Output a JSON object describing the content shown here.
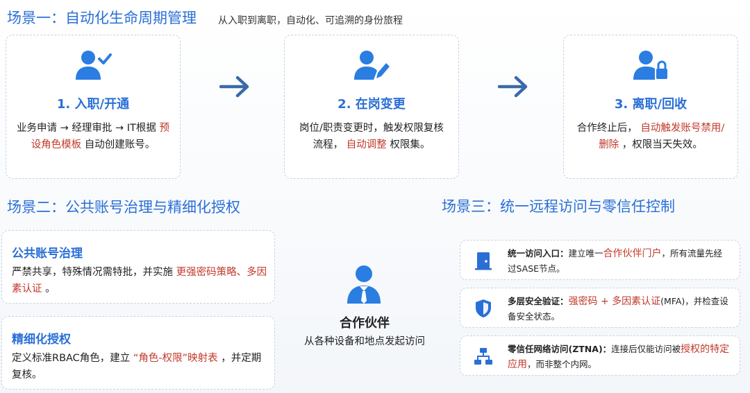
{
  "scene1": {
    "title": "场景一：自动化生命周期管理",
    "subtitle": "从入职到离职，自动化、可追溯的身份旅程",
    "steps": [
      {
        "title": "1. 入职/开通",
        "desc_a": "业务申请 → 经理审批 → IT根据",
        "desc_hl": "预设角色模板",
        "desc_b": "自动创建账号。",
        "icon": "user-check-icon"
      },
      {
        "title": "2. 在岗变更",
        "desc_a": "岗位/职责变更时，触发权限复核流程，",
        "desc_hl": "自动调整",
        "desc_b": "权限集。",
        "icon": "user-edit-icon"
      },
      {
        "title": "3. 离职/回收",
        "desc_a": "合作终止后，",
        "desc_hl": "自动触发账号禁用/删除",
        "desc_b": "，权限当天失效。",
        "icon": "user-lock-icon"
      }
    ]
  },
  "scene2": {
    "title": "场景二：公共账号治理与精细化授权",
    "cards": [
      {
        "title": "公共账号治理",
        "desc_a": "严禁共享，特殊情况需特批，并实施",
        "desc_hl": "更强密码策略、多因素认证",
        "desc_b": "。"
      },
      {
        "title": "精细化授权",
        "desc_a": "定义标准RBAC角色，建立",
        "desc_hl": "“角色-权限”映射表",
        "desc_b": "，并定期复核。"
      }
    ]
  },
  "partner": {
    "title": "合作伙伴",
    "subtitle": "从各种设备和地点发起访问",
    "icon": "partner-user-icon"
  },
  "scene3": {
    "title": "场景三：统一远程访问与零信任控制",
    "items": [
      {
        "label": "统一访问入口：",
        "desc_a": "建立唯一",
        "desc_hl": "合作伙伴门户",
        "desc_b": "，所有流量先经过SASE节点。",
        "icon": "door-icon"
      },
      {
        "label": "多层安全验证：",
        "desc_a": "",
        "desc_hl": "强密码 + 多因素认证",
        "desc_b": "(MFA)，并检查设备安全状态。",
        "icon": "shield-icon"
      },
      {
        "label": "零信任网络访问(ZTNA)：",
        "desc_a": "连接后仅能访问被",
        "desc_hl": "授权的特定应用",
        "desc_b": "，而非整个内网。",
        "icon": "network-icon"
      }
    ]
  },
  "colors": {
    "accent": "#2a6fd6",
    "highlight": "#c0392b"
  }
}
